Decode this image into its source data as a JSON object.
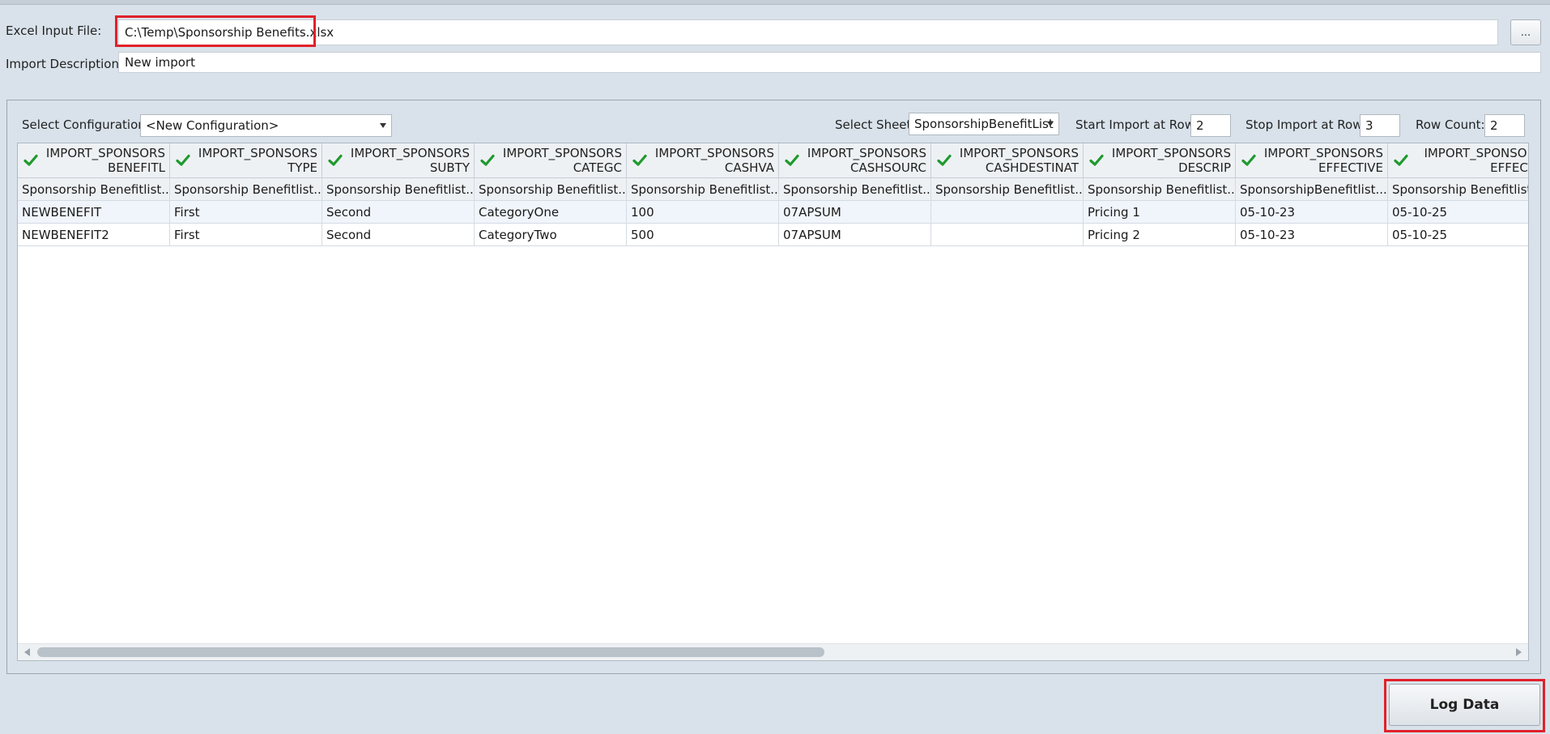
{
  "form": {
    "excel_input_label": "Excel Input File:",
    "excel_input_value": "C:\\Temp\\Sponsorship Benefits.xlsx",
    "browse_label": "...",
    "import_description_label": "Import Description:",
    "import_description_value": "New import"
  },
  "config": {
    "select_configuration_label": "Select Configuration",
    "configuration_value": "<New Configuration>",
    "select_sheet_label": "Select Sheet",
    "sheet_value": "SponsorshipBenefitList",
    "start_import_label": "Start Import at Row:",
    "start_import_value": "2",
    "stop_import_label": "Stop Import at Row:",
    "stop_import_value": "3",
    "row_count_label": "Row Count:",
    "row_count_value": "2"
  },
  "grid": {
    "headers": [
      {
        "line1": "IMPORT_SPONSORS",
        "line2": "BENEFITL"
      },
      {
        "line1": "IMPORT_SPONSORS",
        "line2": "TYPE"
      },
      {
        "line1": "IMPORT_SPONSORS",
        "line2": "SUBTY"
      },
      {
        "line1": "IMPORT_SPONSORS",
        "line2": "CATEGC"
      },
      {
        "line1": "IMPORT_SPONSORS",
        "line2": "CASHVA"
      },
      {
        "line1": "IMPORT_SPONSORS",
        "line2": "CASHSOURC"
      },
      {
        "line1": "IMPORT_SPONSORS",
        "line2": "CASHDESTINAT"
      },
      {
        "line1": "IMPORT_SPONSORS",
        "line2": "DESCRIP"
      },
      {
        "line1": "IMPORT_SPONSORS",
        "line2": "EFFECTIVE"
      },
      {
        "line1": "IMPORT_SPONSOR",
        "line2": "EFFECT"
      }
    ],
    "mapping_row": [
      "Sponsorship Benefitlist...",
      "Sponsorship Benefitlist...",
      "Sponsorship Benefitlist...",
      "Sponsorship Benefitlist...",
      "Sponsorship Benefitlist...",
      "Sponsorship Benefitlist...",
      "Sponsorship Benefitlist...",
      "Sponsorship Benefitlist...",
      "SponsorshipBenefitlist...",
      "Sponsorship Benefitlist..."
    ],
    "rows": [
      [
        "NEWBENEFIT",
        "First",
        "Second",
        "CategoryOne",
        "100",
        "07APSUM",
        "",
        "Pricing 1",
        "05-10-23",
        "05-10-25"
      ],
      [
        "NEWBENEFIT2",
        "First",
        "Second",
        "CategoryTwo",
        "500",
        "07APSUM",
        "",
        "Pricing 2",
        "05-10-23",
        "05-10-25"
      ]
    ],
    "check_color": "#1e9a2c"
  },
  "actions": {
    "log_data_label": "Log Data"
  },
  "accent_highlight": "#e0212a"
}
